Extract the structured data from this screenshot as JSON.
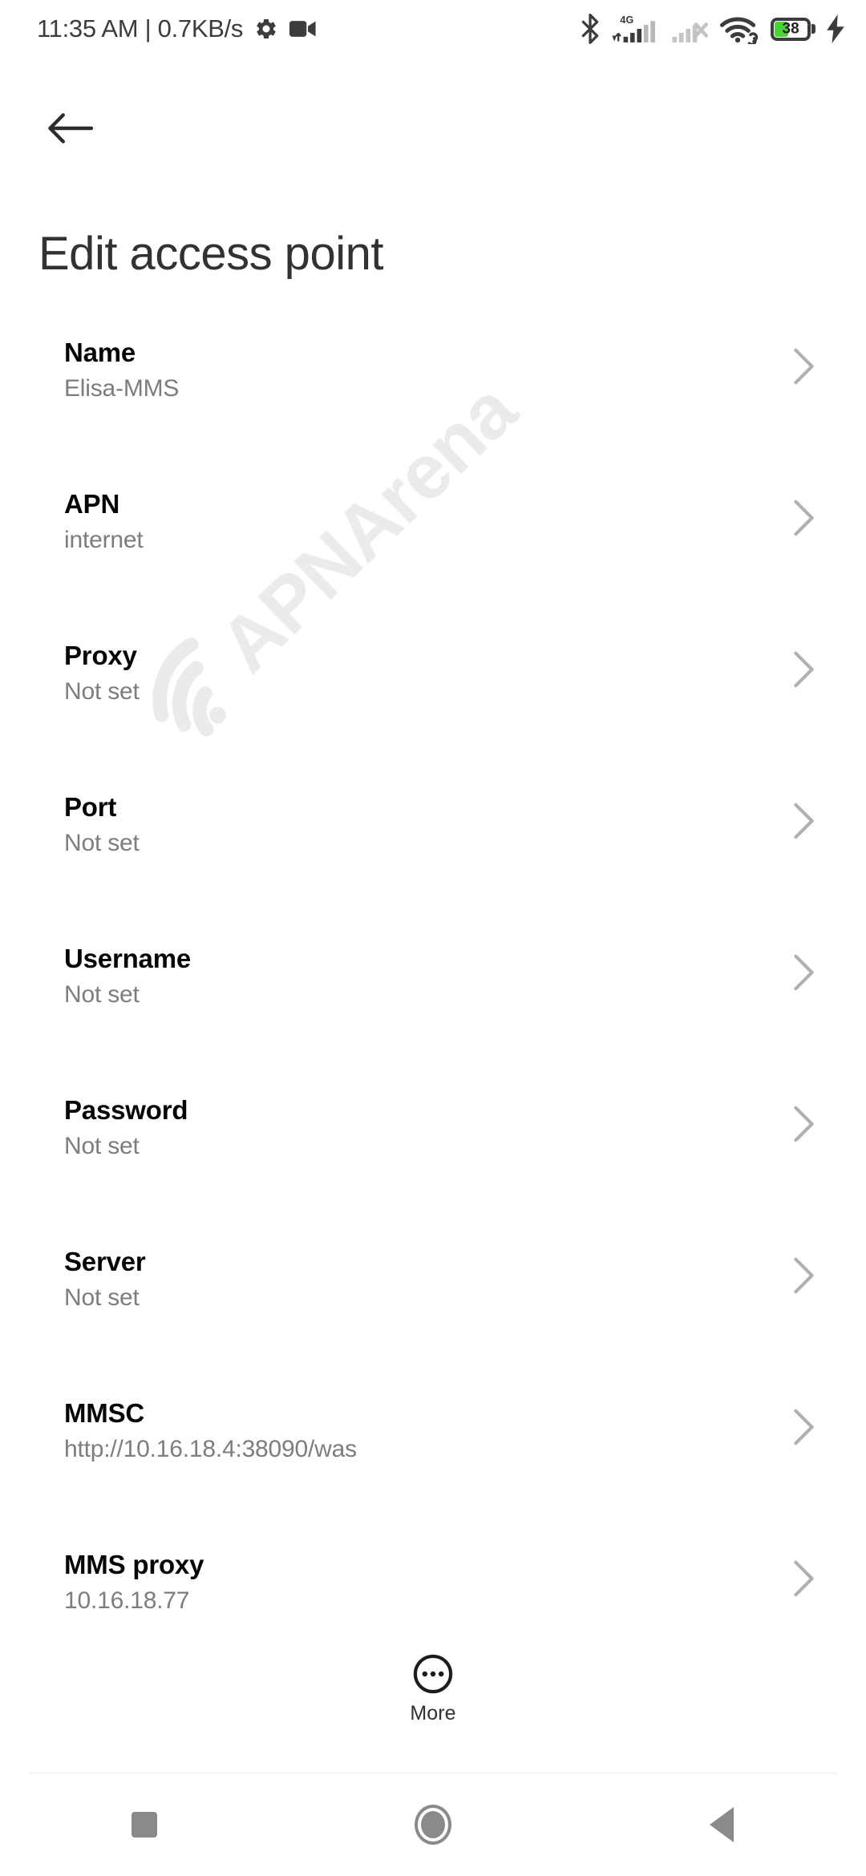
{
  "status_bar": {
    "clock_and_rate": "11:35 AM | 0.7KB/s",
    "icons": [
      "gear-icon",
      "video-camera-icon",
      "bluetooth-icon",
      "signal-4g-icon",
      "signal-sim2-no-service-icon",
      "wifi-icon",
      "battery-icon",
      "charging-bolt-icon"
    ],
    "network_type": "4G",
    "battery_level": "38",
    "battery_color": "#4cd137"
  },
  "header": {
    "back_icon": "arrow-left-icon",
    "title": "Edit access point"
  },
  "watermark": {
    "text": "APNArena",
    "color": "#ebebeb"
  },
  "settings": {
    "rows": [
      {
        "label": "Name",
        "value": "Elisa-MMS"
      },
      {
        "label": "APN",
        "value": "internet"
      },
      {
        "label": "Proxy",
        "value": "Not set"
      },
      {
        "label": "Port",
        "value": "Not set"
      },
      {
        "label": "Username",
        "value": "Not set"
      },
      {
        "label": "Password",
        "value": "Not set"
      },
      {
        "label": "Server",
        "value": "Not set"
      },
      {
        "label": "MMSC",
        "value": "http://10.16.18.4:38090/was"
      },
      {
        "label": "MMS proxy",
        "value": "10.16.18.77"
      }
    ],
    "chevron_icon": "chevron-right-icon"
  },
  "more_button": {
    "label": "More",
    "icon": "more-circle-icon"
  },
  "nav_bar": {
    "recents": "recents-square-icon",
    "home": "home-circle-icon",
    "back": "back-triangle-icon"
  }
}
